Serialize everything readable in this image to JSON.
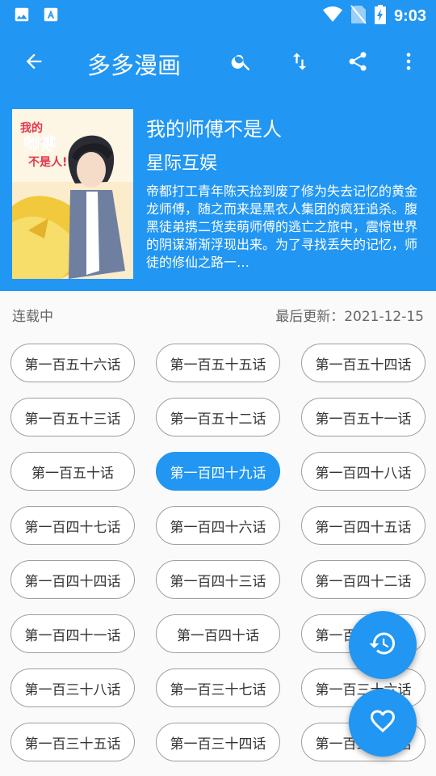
{
  "toolbar": {
    "title": "多多漫画",
    "back_icon": "arrow-back-icon",
    "search_icon": "search-icon",
    "sort_icon": "sort-icon",
    "share_icon": "share-icon",
    "more_icon": "more-vert-icon"
  },
  "statusbar": {
    "time": "9:03"
  },
  "comic": {
    "title": "我的师傅不是人",
    "author": "星际互娱",
    "description": "帝都打工青年陈天捡到废了修为失去记忆的黄金龙师傅，随之而来是黑衣人集团的疯狂追杀。腹黑徒弟携二货卖萌师傅的逃亡之旅中，震惊世界的阴谋渐渐浮现出来。为了寻找丢失的记忆，师徒的修仙之路一…",
    "cover_text_line1": "我的",
    "cover_text_line2": "师傅",
    "cover_text_line3": "不是人!"
  },
  "meta": {
    "status": "连载中",
    "last_update": "最后更新：2021-12-15"
  },
  "chapters": [
    {
      "label": "第一百五十六话",
      "active": false
    },
    {
      "label": "第一百五十五话",
      "active": false
    },
    {
      "label": "第一百五十四话",
      "active": false
    },
    {
      "label": "第一百五十三话",
      "active": false
    },
    {
      "label": "第一百五十二话",
      "active": false
    },
    {
      "label": "第一百五十一话",
      "active": false
    },
    {
      "label": "第一百五十话",
      "active": false
    },
    {
      "label": "第一百四十九话",
      "active": true
    },
    {
      "label": "第一百四十八话",
      "active": false
    },
    {
      "label": "第一百四十七话",
      "active": false
    },
    {
      "label": "第一百四十六话",
      "active": false
    },
    {
      "label": "第一百四十五话",
      "active": false
    },
    {
      "label": "第一百四十四话",
      "active": false
    },
    {
      "label": "第一百四十三话",
      "active": false
    },
    {
      "label": "第一百四十二话",
      "active": false
    },
    {
      "label": "第一百四十一话",
      "active": false
    },
    {
      "label": "第一百四十话",
      "active": false
    },
    {
      "label": "第一百三十九话",
      "active": false
    },
    {
      "label": "第一百三十八话",
      "active": false
    },
    {
      "label": "第一百三十七话",
      "active": false
    },
    {
      "label": "第一百三十六话",
      "active": false
    },
    {
      "label": "第一百三十五话",
      "active": false
    },
    {
      "label": "第一百三十四话",
      "active": false
    },
    {
      "label": "第一百三十三话",
      "active": false
    }
  ],
  "fabs": {
    "history_icon": "history-icon",
    "favorite_icon": "heart-icon"
  },
  "colors": {
    "primary": "#2196f3",
    "chip_border": "#9e9e9e",
    "background": "#fafafa"
  }
}
